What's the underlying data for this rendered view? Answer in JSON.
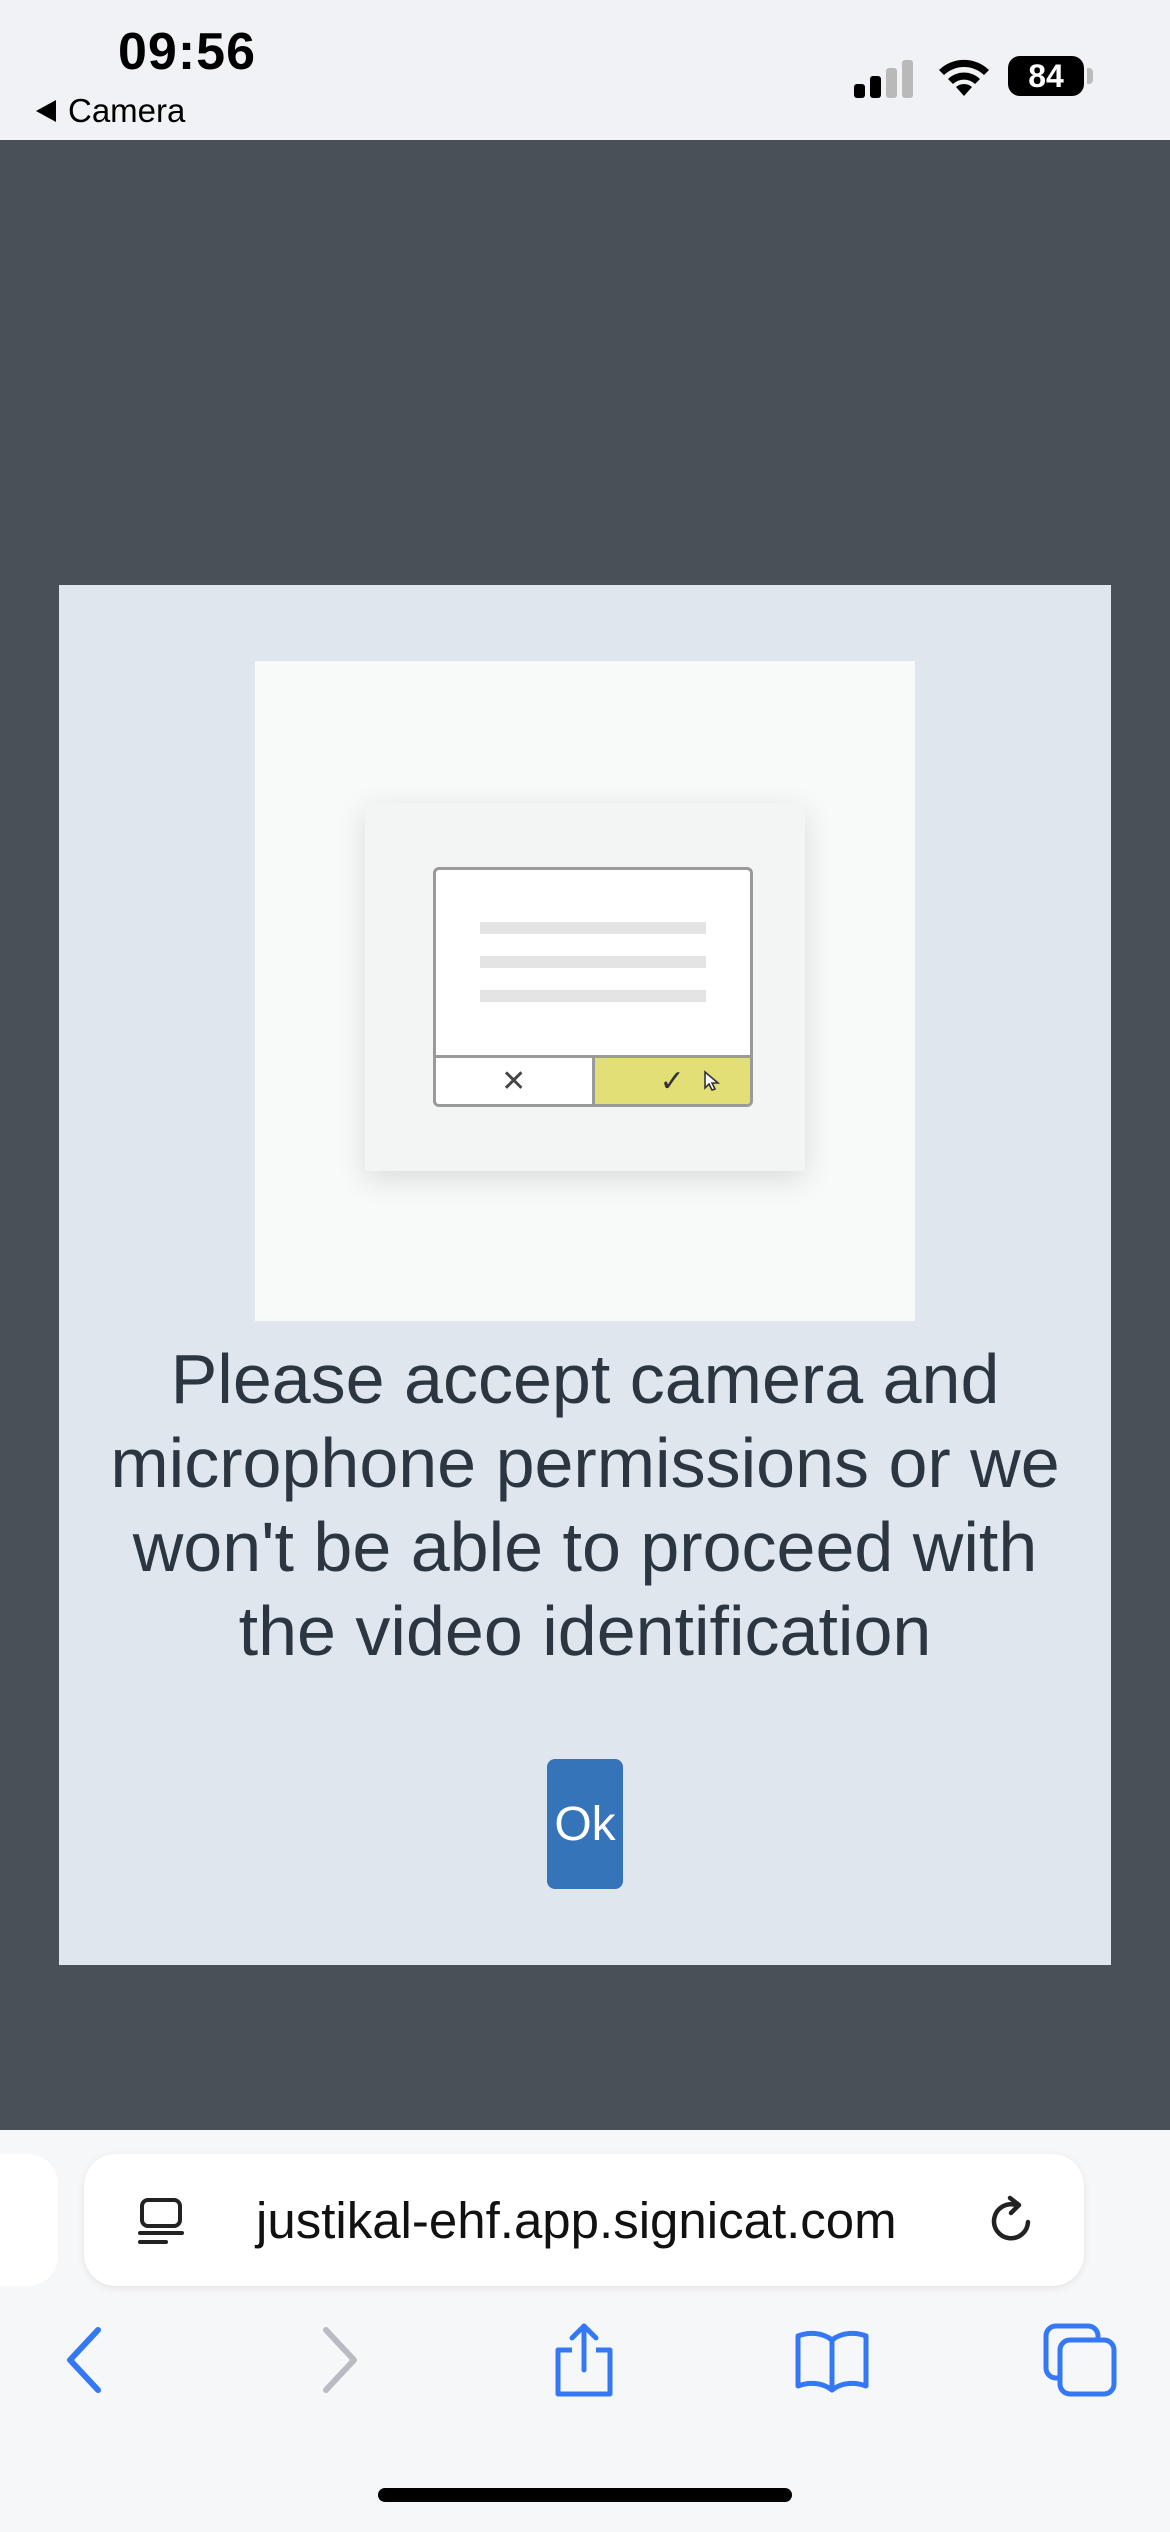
{
  "status_bar": {
    "time": "09:56",
    "back_app": "Camera",
    "battery": "84",
    "icons": [
      "cellular-signal-icon",
      "wifi-icon",
      "battery-icon"
    ]
  },
  "dialog": {
    "message": "Please accept camera and microphone permissions or we won't be able to proceed with the video identification",
    "ok_label": "Ok",
    "illustration": {
      "cancel_glyph": "✕",
      "confirm_glyph": "✓"
    }
  },
  "browser": {
    "url": "justikal-ehf.app.signicat.com",
    "toolbar_icons": [
      "back-icon",
      "forward-icon",
      "share-icon",
      "bookmarks-icon",
      "tabs-icon"
    ]
  },
  "colors": {
    "backdrop": "#495056",
    "dialog_bg": "#dfe6ee",
    "ok_button": "#3574b8",
    "text": "#2b3640",
    "browser_accent": "#3478f6",
    "confirm_highlight": "#e3df77"
  }
}
